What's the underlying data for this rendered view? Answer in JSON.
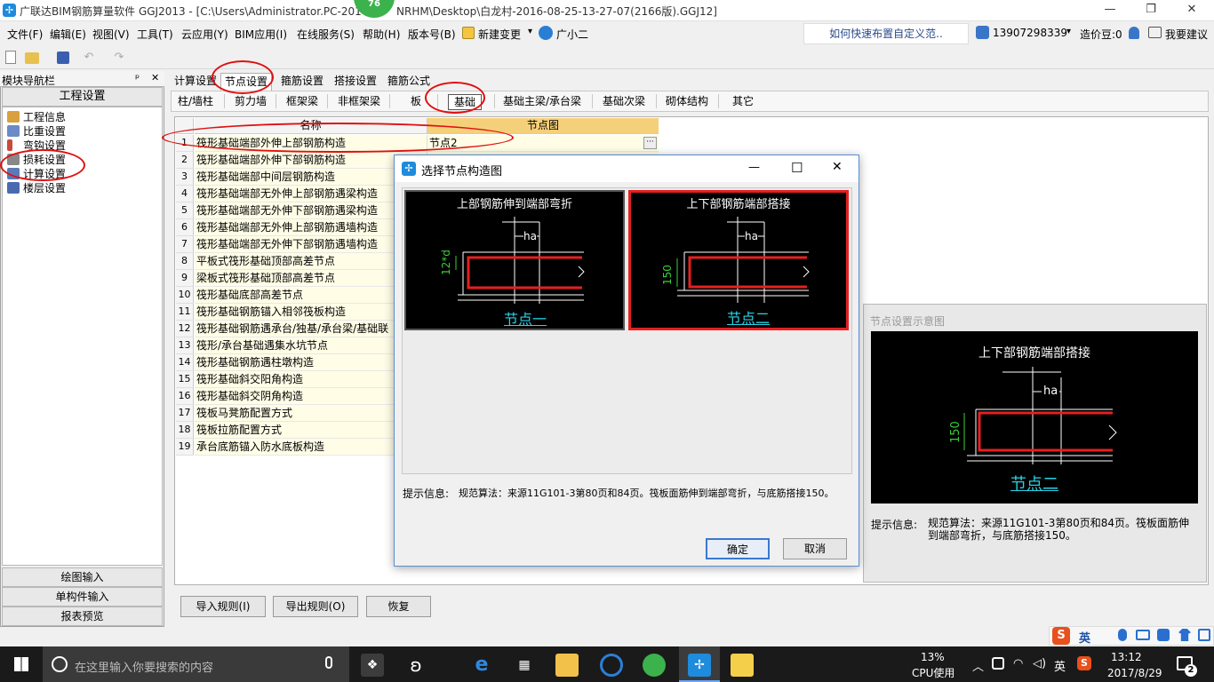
{
  "window": {
    "title": "广联达BIM钢筋算量软件 GGJ2013 - [C:\\Users\\Administrator.PC-201",
    "title_tail": "NRHM\\Desktop\\白龙村-2016-08-25-13-27-07(2166版).GGJ12]",
    "badge": "76",
    "minimize": "—",
    "maximize": "❐",
    "close": "✕"
  },
  "menubar": {
    "items": [
      "文件(F)",
      "编辑(E)",
      "视图(V)",
      "工具(T)",
      "云应用(Y)",
      "BIM应用(I)",
      "在线服务(S)",
      "帮助(H)",
      "版本号(B)",
      "新建变更",
      "广小二"
    ],
    "new_change_arrow": "▾",
    "tip": "如何快速布置自定义范..",
    "phone": "13907298339",
    "phone_arrow": "▾",
    "coins": "造价豆:0",
    "suggest": "我要建议"
  },
  "nav": {
    "header": "模块导航栏",
    "pin": "ᵖ",
    "close": "✕",
    "tab": "工程设置",
    "items": [
      "工程信息",
      "比重设置",
      "弯钩设置",
      "损耗设置",
      "计算设置",
      "楼层设置"
    ],
    "bottom": [
      "绘图输入",
      "单构件输入",
      "报表预览"
    ]
  },
  "tabs": [
    "计算设置",
    "节点设置",
    "箍筋设置",
    "搭接设置",
    "箍筋公式"
  ],
  "subtabs": [
    "柱/墙柱",
    "剪力墙",
    "框架梁",
    "非框架梁",
    "板",
    "基础",
    "基础主梁/承台梁",
    "基础次梁",
    "砌体结构",
    "其它"
  ],
  "grid": {
    "col_name": "名称",
    "col_node": "节点图",
    "rows": [
      {
        "n": "1",
        "name": "筏形基础端部外伸上部钢筋构造",
        "val": "节点2"
      },
      {
        "n": "2",
        "name": "筏形基础端部外伸下部钢筋构造",
        "val": ""
      },
      {
        "n": "3",
        "name": "筏形基础端部中间层钢筋构造",
        "val": ""
      },
      {
        "n": "4",
        "name": "筏形基础端部无外伸上部钢筋遇梁构造",
        "val": ""
      },
      {
        "n": "5",
        "name": "筏形基础端部无外伸下部钢筋遇梁构造",
        "val": ""
      },
      {
        "n": "6",
        "name": "筏形基础端部无外伸上部钢筋遇墙构造",
        "val": ""
      },
      {
        "n": "7",
        "name": "筏形基础端部无外伸下部钢筋遇墙构造",
        "val": ""
      },
      {
        "n": "8",
        "name": "平板式筏形基础顶部高差节点",
        "val": ""
      },
      {
        "n": "9",
        "name": "梁板式筏形基础顶部高差节点",
        "val": ""
      },
      {
        "n": "10",
        "name": "筏形基础底部高差节点",
        "val": ""
      },
      {
        "n": "11",
        "name": "筏形基础钢筋锚入相邻筏板构造",
        "val": ""
      },
      {
        "n": "12",
        "name": "筏形基础钢筋遇承台/独基/承台梁/基础联",
        "val": ""
      },
      {
        "n": "13",
        "name": "筏形/承台基础遇集水坑节点",
        "val": ""
      },
      {
        "n": "14",
        "name": "筏形基础钢筋遇柱墩构造",
        "val": ""
      },
      {
        "n": "15",
        "name": "筏形基础斜交阳角构造",
        "val": ""
      },
      {
        "n": "16",
        "name": "筏形基础斜交阴角构造",
        "val": ""
      },
      {
        "n": "17",
        "name": "筏板马凳筋配置方式",
        "val": ""
      },
      {
        "n": "18",
        "name": "筏板拉筋配置方式",
        "val": ""
      },
      {
        "n": "19",
        "name": "承台底筋锚入防水底板构造",
        "val": ""
      }
    ],
    "dots": "···"
  },
  "bottom_buttons": [
    "导入规则(I)",
    "导出规则(O)",
    "恢复"
  ],
  "preview": {
    "title": "节点设置示意图",
    "diagram_title": "上下部钢筋端部搭接",
    "dim_ha": "ha",
    "dim_150": "150",
    "node_label": "节点二",
    "tip_label": "提示信息:",
    "tip_text": "规范算法：来源11G101-3第80页和84页。筏板面筋伸到端部弯折，与底筋搭接150。"
  },
  "dialog": {
    "title": "选择节点构造图",
    "min": "—",
    "max": "☐",
    "close": "✕",
    "option1_title": "上部钢筋伸到端部弯折",
    "option1_dim": "12*d",
    "option1_label": "节点一",
    "option2_title": "上下部钢筋端部搭接",
    "option2_dim": "150",
    "option2_label": "节点二",
    "dim_ha": "ha",
    "tip_label": "提示信息:",
    "tip_text": "规范算法：来源11G101-3第80页和84页。筏板面筋伸到端部弯折，与底筋搭接150。",
    "ok": "确定",
    "cancel": "取消"
  },
  "ime": {
    "label": "英"
  },
  "taskbar": {
    "search_placeholder": "在这里输入你要搜索的内容",
    "cpu_percent": "13%",
    "cpu_label": "CPU使用",
    "lang": "英",
    "time": "13:12",
    "date": "2017/8/29",
    "notif_count": "2"
  }
}
